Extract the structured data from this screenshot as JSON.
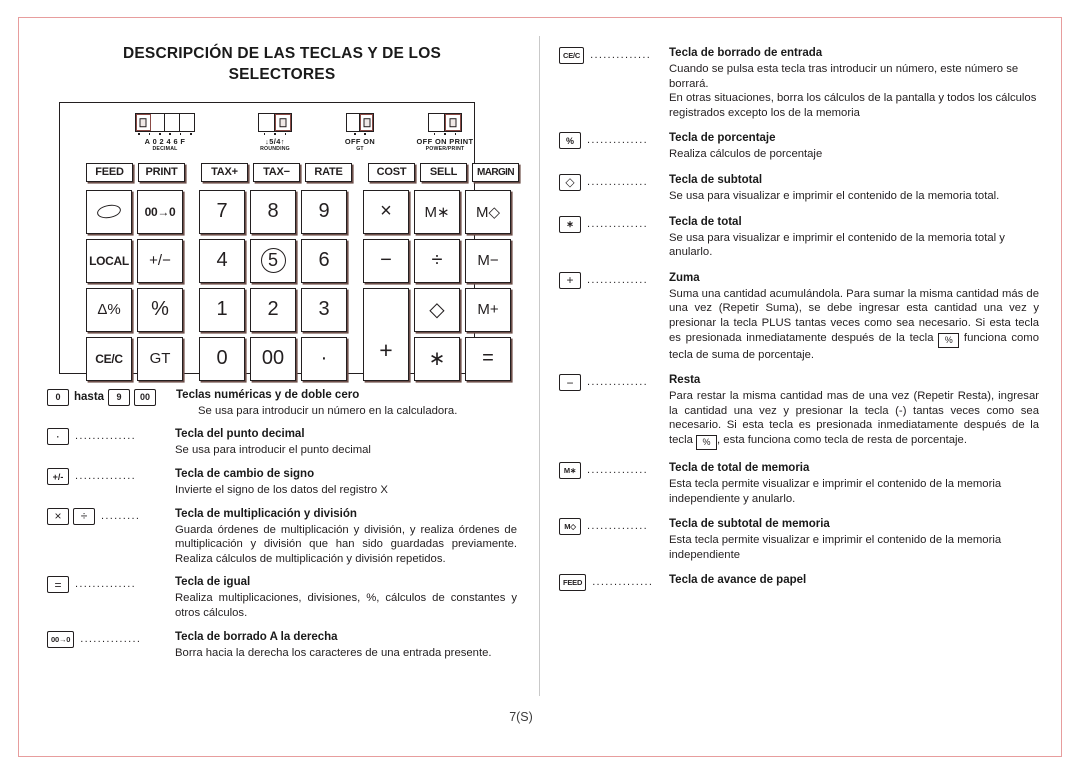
{
  "page": {
    "title_line1": "DESCRIPCIÓN DE LAS TECLAS Y DE LOS",
    "title_line2": "SELECTORES",
    "page_number": "7(S)",
    "border_color": "#e79d9d",
    "ink_color": "#231f20"
  },
  "calculator": {
    "selectors": [
      {
        "name": "decimal",
        "label": "A 0 2 4 6 F",
        "sub": "DECIMAL",
        "cells": 4,
        "active_index": 0,
        "ticks": 6
      },
      {
        "name": "rounding",
        "label": "↓5/4↑",
        "sub": "ROUNDING",
        "cells": 2,
        "active_index": 1,
        "ticks": 3
      },
      {
        "name": "gt",
        "label": "OFF ON",
        "sub": "GT",
        "cells": 2,
        "active_index": 1,
        "ticks": 2
      },
      {
        "name": "power-print",
        "label": "OFF  ON  PRINT",
        "sub": "POWER/PRINT",
        "cells": 2,
        "active_index": 1,
        "ticks": 3
      }
    ],
    "function_keys": [
      "FEED",
      "PRINT",
      "TAX+",
      "TAX−",
      "RATE",
      "COST",
      "SELL",
      "MARGIN"
    ],
    "keypad_rows": [
      [
        "○",
        "00→0",
        "7",
        "8",
        "9",
        "×",
        "M∗",
        "M◇"
      ],
      [
        "LOCAL",
        "+/−",
        "4",
        "5",
        "6",
        "−",
        "÷",
        "M−"
      ],
      [
        "Δ%",
        "%",
        "1",
        "2",
        "3",
        "+",
        "◇",
        "M+"
      ],
      [
        "CE/C",
        "GT",
        "0",
        "00",
        "·",
        "",
        "∗",
        "="
      ]
    ]
  },
  "left_descriptions": [
    {
      "keys": [
        "0",
        "9",
        "00"
      ],
      "hasta": "hasta",
      "dots": "",
      "title": "Teclas numéricas y de doble cero",
      "text": "Se usa para introducir un número en la calculadora.",
      "justify": false
    },
    {
      "keys": [
        "·"
      ],
      "dots": "..............",
      "title": "Tecla del punto decimal",
      "text": "Se usa para introducir el punto decimal",
      "justify": false
    },
    {
      "keys": [
        "+/-"
      ],
      "dots": "..............",
      "title": "Tecla de cambio de signo",
      "text": "Invierte el signo de los datos del registro X",
      "justify": false
    },
    {
      "keys": [
        "×",
        "÷"
      ],
      "dots": ".........",
      "title": "Tecla de multiplicación y división",
      "text": "Guarda órdenes de multiplicación y división, y realiza órdenes de multiplicación y división que han sido guardadas previamente. Realiza cálculos de multiplicación y división repetidos.",
      "justify": true
    },
    {
      "keys": [
        "="
      ],
      "dots": "..............",
      "title": "Tecla de igual",
      "text": "Realiza multiplicaciones, divisiones, %, cálculos de constantes y otros cálculos.",
      "justify": true
    },
    {
      "keys": [
        "00→0"
      ],
      "dots": "..............",
      "title": "Tecla de borrado A la derecha",
      "text": "Borra hacia la derecha los caracteres de una entrada presente.",
      "justify": true
    }
  ],
  "right_descriptions": [
    {
      "keys": [
        "CE/C"
      ],
      "dots": "..............",
      "title": "Tecla de borrado de entrada",
      "text": "Cuando se pulsa esta tecla tras introducir un número, este número se borrará.\nEn otras situaciones, borra los cálculos de la pantalla y todos los cálculos registrados excepto los de la memoria",
      "justify": false
    },
    {
      "keys": [
        "%"
      ],
      "dots": "..............",
      "title": "Tecla de porcentaje",
      "text": "Realiza cálculos de porcentaje",
      "justify": false
    },
    {
      "keys": [
        "◇"
      ],
      "dots": "..............",
      "title": "Tecla de subtotal",
      "text": "Se usa para visualizar e imprimir el contenido de la memoria total.",
      "justify": false
    },
    {
      "keys": [
        "∗"
      ],
      "dots": "..............",
      "title": "Tecla de total",
      "text": "Se usa para visualizar e imprimir el contenido de la memoria total y anularlo.",
      "justify": false
    },
    {
      "keys": [
        "+"
      ],
      "dots": "..............",
      "title": "Zuma",
      "text_before": "Suma una cantidad acumulándola. Para  sumar la misma cantidad más de una vez  (Repetir Suma), se debe ingresar esta cantidad una vez y presionar la tecla  PLUS tantas veces como sea necesario. Si esta tecla es presionada inmediatamente después de la tecla ",
      "inline_key": "%",
      "text_after": " funciona como tecla de suma de porcentaje.",
      "justify": true
    },
    {
      "keys": [
        "−"
      ],
      "dots": "..............",
      "title": "Resta",
      "text_before": "Para restar la misma cantidad mas de una vez (Repetir Resta), ingresar la cantidad una vez y presionar la tecla (-) tantas veces como sea necesario. Si esta tecla es presionada inmediatamente después de la tecla ",
      "inline_key": "%",
      "text_after": ", esta funciona como tecla de resta de porcentaje.",
      "justify": true
    },
    {
      "keys": [
        "M∗"
      ],
      "dots": "..............",
      "title": "Tecla de total de memoria",
      "text": "Esta tecla permite visualizar e imprimir el contenido de la memoria independiente y anularlo.",
      "justify": false
    },
    {
      "keys": [
        "M◇"
      ],
      "dots": "..............",
      "title": "Tecla de subtotal de memoria",
      "text": "Esta tecla permite visualizar e imprimir el contenido de la memoria independiente",
      "justify": false
    },
    {
      "keys": [
        "FEED"
      ],
      "dots": "..............",
      "title": "Tecla de avance de papel",
      "text": "",
      "justify": false
    }
  ]
}
